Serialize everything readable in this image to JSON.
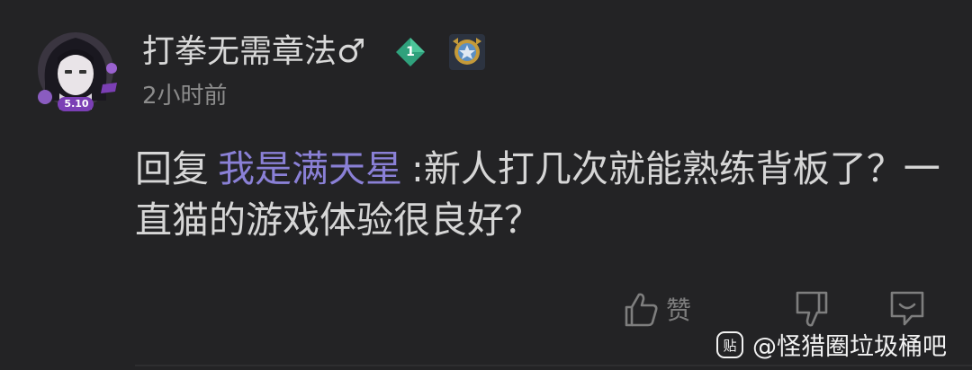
{
  "user": {
    "name": "打拳无需章法♂",
    "level": "1",
    "avatar_badge": "5.10"
  },
  "timestamp": "2小时前",
  "reply": {
    "prefix": "回复",
    "mention": "我是满天星",
    "text": ":新人打几次就能熟练背板了？一直猫的游戏体验很良好？"
  },
  "actions": {
    "like_label": "赞"
  },
  "watermark": {
    "text": "@怪猎圈垃圾桶吧",
    "logo_text": "贴"
  },
  "colors": {
    "background": "#232325",
    "mention": "#8a80d6",
    "level_badge": "#2fa17c"
  },
  "icons": {
    "like": "thumbs-up-icon",
    "dislike": "thumbs-down-icon",
    "reply": "reply-bubble-icon",
    "medal": "medal-badge-icon"
  }
}
